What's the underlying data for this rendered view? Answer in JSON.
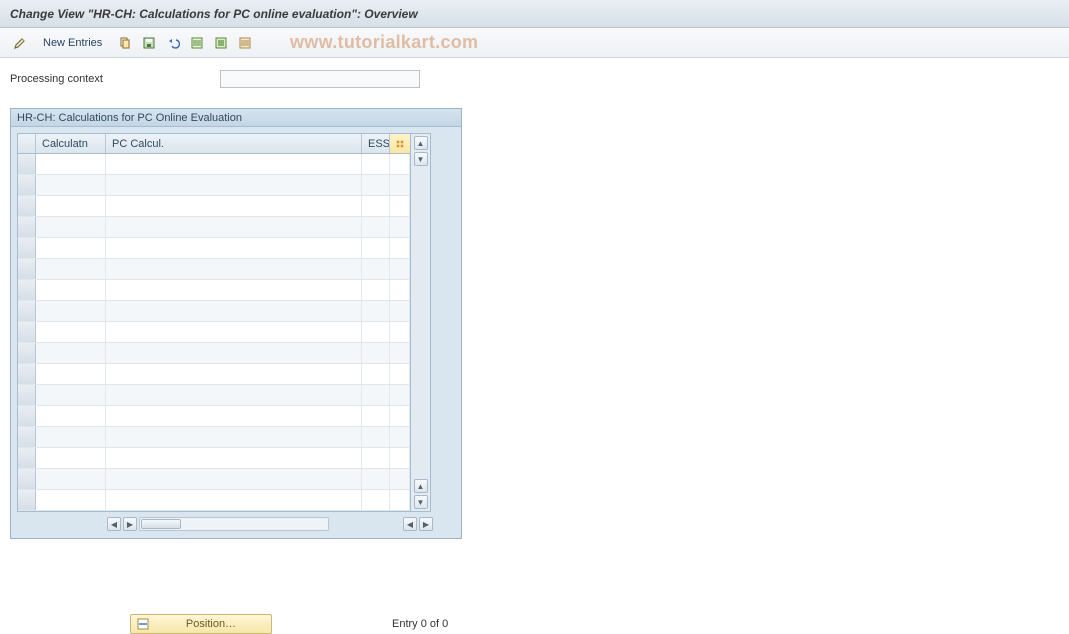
{
  "header": {
    "title": "Change View \"HR-CH: Calculations for PC online evaluation\": Overview"
  },
  "toolbar": {
    "new_entries_label": "New Entries",
    "icons": {
      "edit": "edit-icon",
      "copy": "copy-icon",
      "save": "save-icon",
      "undo": "undo-icon",
      "select_all": "select-all-icon",
      "select_block": "select-block-icon",
      "deselect": "deselect-icon"
    }
  },
  "watermark": "www.tutorialkart.com",
  "fields": {
    "processing_context_label": "Processing context",
    "processing_context_value": ""
  },
  "panel": {
    "title": "HR-CH: Calculations for PC Online Evaluation",
    "columns": {
      "c1": "Calculatn",
      "c2": "PC Calcul.",
      "c3": "ESS"
    },
    "row_count": 17
  },
  "footer": {
    "position_label": "Position…",
    "entry_status": "Entry 0 of 0"
  }
}
